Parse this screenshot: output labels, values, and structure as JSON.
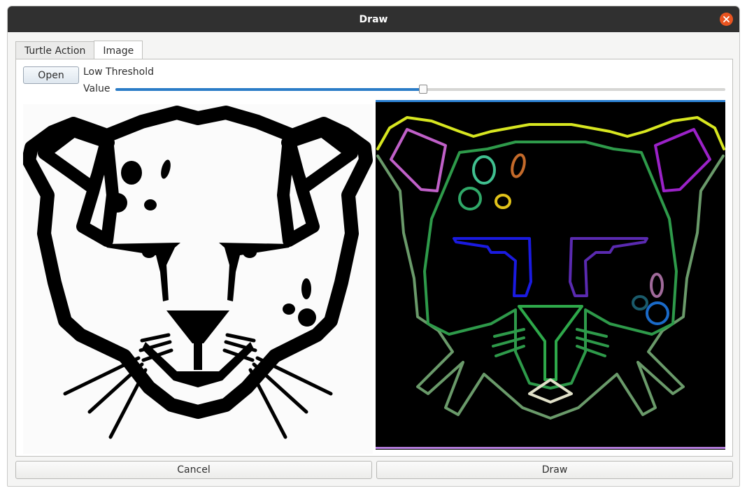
{
  "window": {
    "title": "Draw",
    "close_icon": "close-icon"
  },
  "tabs": [
    {
      "label": "Turtle Action",
      "active": false
    },
    {
      "label": "Image",
      "active": true
    }
  ],
  "image_tab": {
    "open_label": "Open",
    "threshold_label": "Low Threshold",
    "value_label": "Value",
    "slider_fraction": 0.505
  },
  "buttons": {
    "cancel_label": "Cancel",
    "draw_label": "Draw"
  },
  "colors": {
    "titlebar": "#303030",
    "close": "#e95420",
    "slider_fill": "#2b7cc7"
  }
}
